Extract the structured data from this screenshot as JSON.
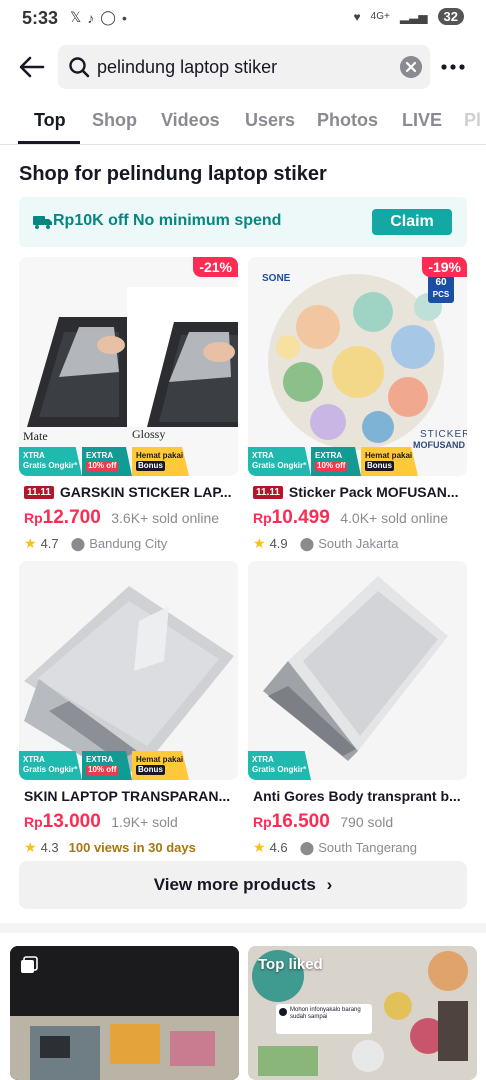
{
  "status_bar": {
    "time": "5:33",
    "network": "4G+",
    "battery": "32"
  },
  "search": {
    "query": "pelindung laptop stiker"
  },
  "tabs": [
    "Top",
    "Shop",
    "Videos",
    "Users",
    "Photos",
    "LIVE",
    "Pl"
  ],
  "shop": {
    "title": "Shop for pelindung laptop stiker",
    "coupon_text": "Rp10K off No minimum spend",
    "claim_label": "Claim",
    "promo": {
      "xtra": "XTRA",
      "xtra_sub": "Gratis Ongkir*",
      "extra": "EXTRA",
      "extra_sub": "10% off",
      "hemat": "Hemat pakai",
      "hemat_sub": "Bonus"
    },
    "products": [
      {
        "discount": "-21%",
        "badge": "11.11",
        "title": "GARSKIN STICKER LAP...",
        "currency": "Rp",
        "price": "12.700",
        "sold": "3.6K+ sold online",
        "rating": "4.7",
        "location": "Bandung City",
        "img_label_left": "Mate",
        "img_label_right": "Glossy"
      },
      {
        "discount": "-19%",
        "badge": "11.11",
        "title": "Sticker Pack MOFUSAN...",
        "currency": "Rp",
        "price": "10.499",
        "sold": "4.0K+ sold online",
        "rating": "4.9",
        "location": "South Jakarta",
        "img_brand": "SONE",
        "img_pcs": "60",
        "img_pcs_label": "PCS",
        "img_sticker": "STICKER",
        "img_mofusand": "MOFUSAND"
      },
      {
        "title": "SKIN LAPTOP TRANSPARAN...",
        "currency": "Rp",
        "price": "13.000",
        "sold": "1.9K+ sold",
        "rating": "4.3",
        "views": "100 views in 30 days"
      },
      {
        "title": "Anti Gores Body transprant b...",
        "currency": "Rp",
        "price": "16.500",
        "sold": "790 sold",
        "rating": "4.6",
        "location": "South Tangerang"
      }
    ],
    "view_more": "View more products"
  },
  "videos": [
    {
      "badge": ""
    },
    {
      "badge": "Top liked",
      "comment": "Mohon infonyakalo barang sudah sampai"
    }
  ],
  "colors": {
    "accent": "#fe2c55",
    "teal": "#13a8a3"
  }
}
